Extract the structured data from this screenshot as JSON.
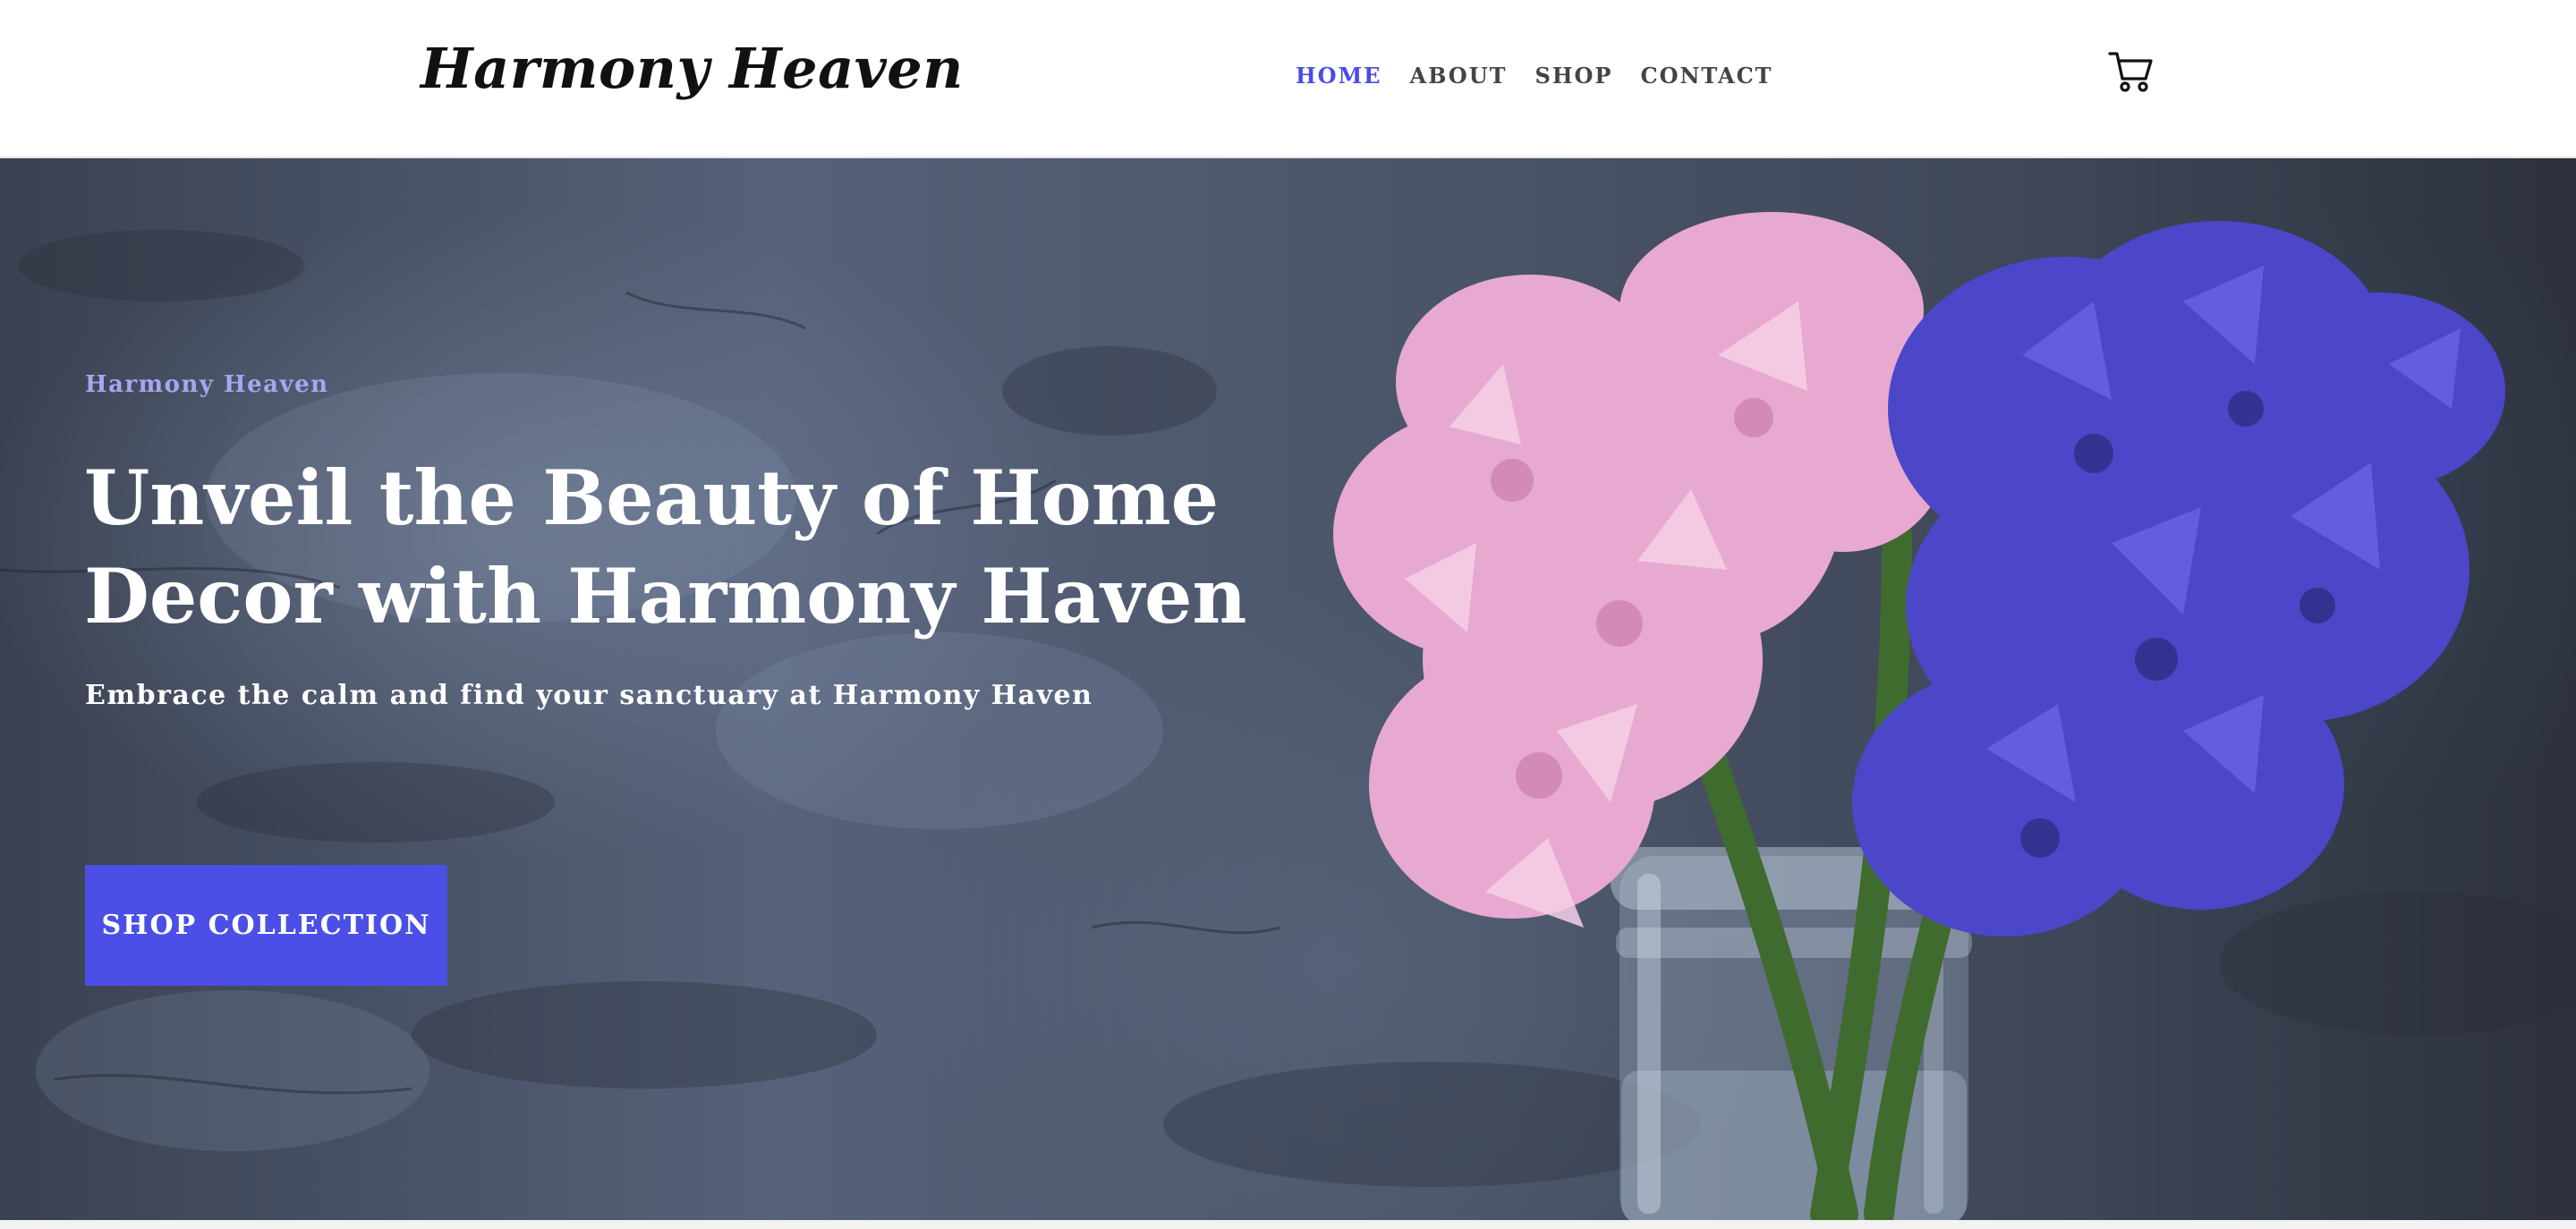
{
  "header": {
    "brand": "Harmony Heaven",
    "nav": [
      {
        "label": "HOME",
        "active": true
      },
      {
        "label": "ABOUT",
        "active": false
      },
      {
        "label": "SHOP",
        "active": false
      },
      {
        "label": "CONTACT",
        "active": false
      }
    ],
    "cart_icon": "shopping-cart-icon"
  },
  "hero": {
    "eyebrow": "Harmony Heaven",
    "headline_line1": "Unveil the Beauty of Home",
    "headline_line2": "Decor with Harmony Haven",
    "subline": "Embrace the calm and find your sanctuary at Harmony Haven",
    "cta_label": "SHOP COLLECTION",
    "image": "pink-and-blue-hyacinths-in-glass-jar"
  },
  "colors": {
    "accent": "#4b4fe6",
    "nav_active": "#4a4de3",
    "eyebrow": "#a7a6f0",
    "hero_text": "#ffffff"
  }
}
